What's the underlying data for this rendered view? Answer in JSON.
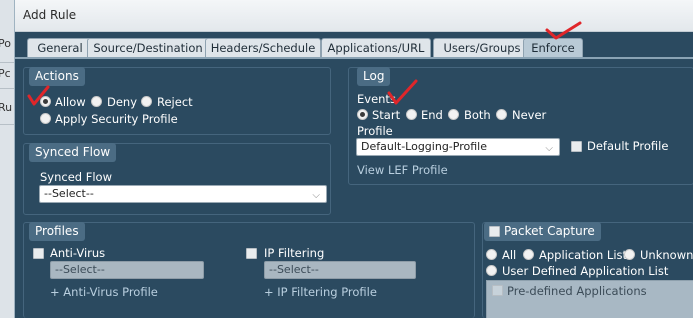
{
  "background": {
    "fragments": [
      "Po",
      "Pc",
      "Ru"
    ]
  },
  "dialog": {
    "title": "Add Rule",
    "tabs": [
      {
        "label": "General",
        "active": false
      },
      {
        "label": "Source/Destination",
        "active": false
      },
      {
        "label": "Headers/Schedule",
        "active": false
      },
      {
        "label": "Applications/URL",
        "active": false
      },
      {
        "label": "Users/Groups",
        "active": false
      },
      {
        "label": "Enforce",
        "active": true
      }
    ]
  },
  "actions": {
    "title": "Actions",
    "options": [
      {
        "label": "Allow",
        "selected": true
      },
      {
        "label": "Deny",
        "selected": false
      },
      {
        "label": "Reject",
        "selected": false
      },
      {
        "label": "Apply Security Profile",
        "selected": false
      }
    ]
  },
  "log": {
    "title": "Log",
    "events_label": "Events",
    "events": [
      {
        "label": "Start",
        "selected": true
      },
      {
        "label": "End",
        "selected": false
      },
      {
        "label": "Both",
        "selected": false
      },
      {
        "label": "Never",
        "selected": false
      }
    ],
    "profile_label": "Profile",
    "profile_value": "Default-Logging-Profile",
    "default_profile_label": "Default Profile",
    "default_profile_checked": false,
    "view_link": "View LEF Profile"
  },
  "synced_flow": {
    "title": "Synced Flow",
    "field_label": "Synced Flow",
    "value": "--Select--"
  },
  "profiles": {
    "title": "Profiles",
    "anti_virus": {
      "label": "Anti-Virus",
      "value": "--Select--",
      "add_link": "+ Anti-Virus Profile",
      "checked": false
    },
    "ip_filtering": {
      "label": "IP Filtering",
      "value": "--Select--",
      "add_link": "+ IP Filtering Profile",
      "checked": false
    }
  },
  "packet_capture": {
    "title": "Packet Capture",
    "checked": false,
    "options": [
      {
        "label": "All",
        "selected": false
      },
      {
        "label": "Application List",
        "selected": false
      },
      {
        "label": "Unknown A",
        "selected": false
      },
      {
        "label": "User Defined Application List",
        "selected": false
      }
    ],
    "list_item": "Pre-defined Applications"
  },
  "colors": {
    "annotation": "#e0262a",
    "panel_bg": "#2b4a60",
    "tab_bg": "#dfe5ea"
  }
}
